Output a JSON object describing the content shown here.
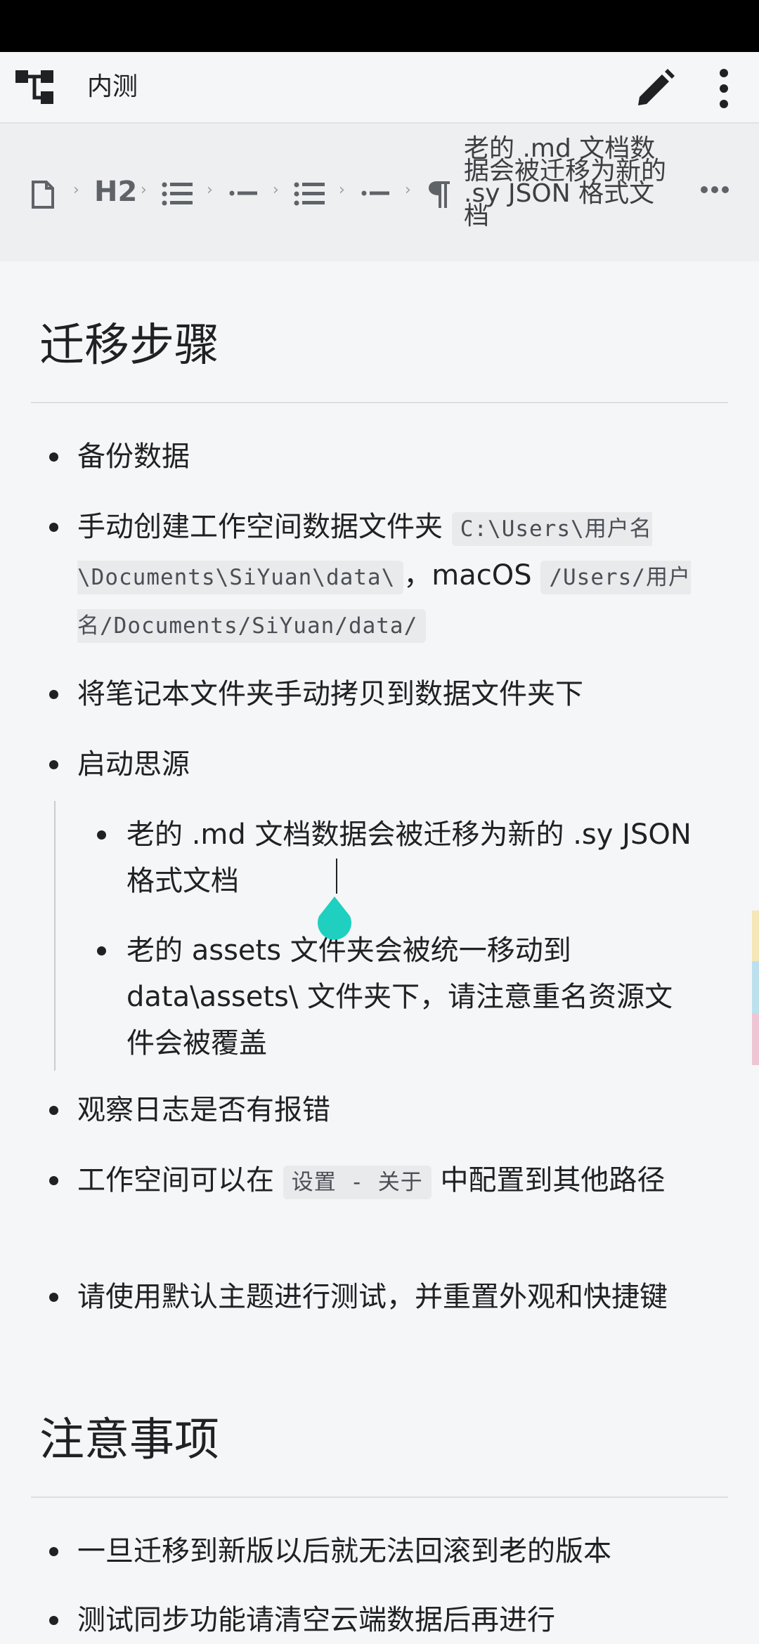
{
  "toolbar": {
    "notebook_title": "内测",
    "icons": [
      "tree-icon",
      "edit-icon",
      "more-vert-icon"
    ]
  },
  "breadcrumb": {
    "items": [
      "document-icon",
      "H2",
      "list-icon",
      "list-item-icon",
      "list-icon",
      "list-item-icon",
      "paragraph-icon"
    ],
    "heading_label": "H2",
    "current_block_text": "老的 .md 文档数据会被迁移为新的 .sy JSON 格式文档"
  },
  "content": {
    "section1_title": "迁移步骤",
    "items": {
      "backup": "备份数据",
      "create_folder_prefix": "手动创建工作空间数据文件夹",
      "create_folder_win_path": "C:\\Users\\用户名\\Documents\\SiYuan\\data\\",
      "create_folder_mac_label": "，macOS",
      "create_folder_mac_path": "/Users/用户名/Documents/SiYuan/data/",
      "copy_notebook": "将笔记本文件夹手动拷贝到数据文件夹下",
      "launch": "启动思源",
      "nested_1": "老的 .md 文档数据会被迁移为新的 .sy JSON 格式文档",
      "nested_2": "老的 assets 文件夹会被统一移动到 data\\assets\\ 文件夹下，请注意重名资源文件会被覆盖",
      "check_log": "观察日志是否有报错",
      "workspace_prefix": "工作空间可以在",
      "workspace_code": "设置 - 关于",
      "workspace_suffix": "中配置到其他路径",
      "theme": "请使用默认主题进行测试，并重置外观和快捷键"
    },
    "section2_title": "注意事项",
    "notes": {
      "no_rollback": "一旦迁移到新版以后就无法回滚到老的版本",
      "sync": "测试同步功能请清空云端数据后再进行"
    }
  },
  "colors": {
    "handle": "#1fd0c0",
    "scroll_marker_yellow": "#f6e7b8",
    "scroll_marker_blue": "#bde0ef",
    "scroll_marker_pink": "#eec6d3"
  }
}
